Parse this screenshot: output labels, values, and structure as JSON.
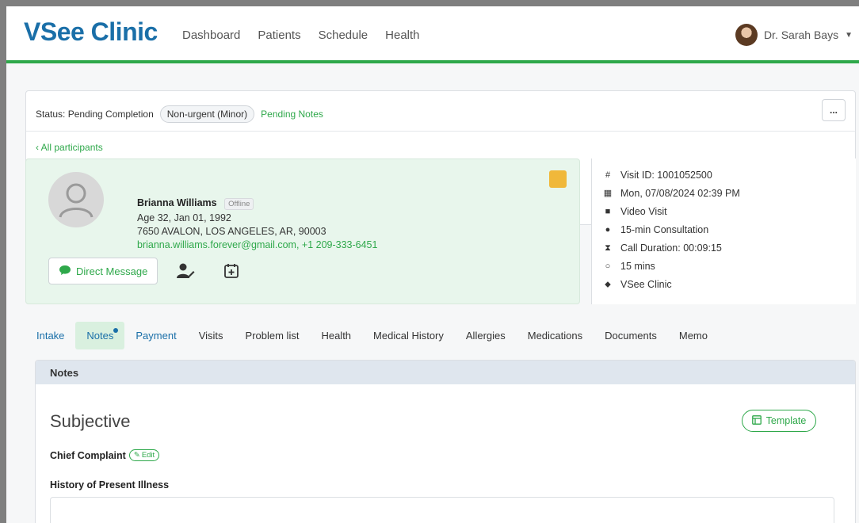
{
  "app": {
    "logo": "VSee Clinic"
  },
  "nav": {
    "items": [
      "Dashboard",
      "Patients",
      "Schedule",
      "Health"
    ]
  },
  "user": {
    "name": "Dr. Sarah Bays"
  },
  "status": {
    "label": "Status: Pending Completion",
    "severity": "Non-urgent (Minor)",
    "pending": "Pending Notes",
    "more": "..."
  },
  "back_link": "All participants",
  "patient": {
    "name": "Brianna Williams",
    "presence": "Offline",
    "age_dob": "Age 32, Jan 01, 1992",
    "address": "7650 AVALON, LOS ANGELES, AR, 90003",
    "contact": "brianna.williams.forever@gmail.com, +1 209-333-6451",
    "dm_label": "Direct Message"
  },
  "visit": {
    "id": "Visit ID: 1001052500",
    "datetime": "Mon, 07/08/2024 02:39 PM",
    "type": "Video Visit",
    "consultation": "15-min Consultation",
    "duration": "Call Duration: 00:09:15",
    "length": "15 mins",
    "location": "VSee Clinic"
  },
  "tabs": [
    "Intake",
    "Notes",
    "Payment",
    "Visits",
    "Problem list",
    "Health",
    "Medical History",
    "Allergies",
    "Medications",
    "Documents",
    "Memo"
  ],
  "notes": {
    "header": "Notes",
    "section": "Subjective",
    "template_label": "Template",
    "chief_complaint": "Chief Complaint",
    "edit_label": "Edit",
    "hpi": "History of Present Illness"
  },
  "colors": {
    "brand_blue": "#1a6fa8",
    "brand_green": "#2ea84a",
    "sticky": "#f0b83a"
  }
}
